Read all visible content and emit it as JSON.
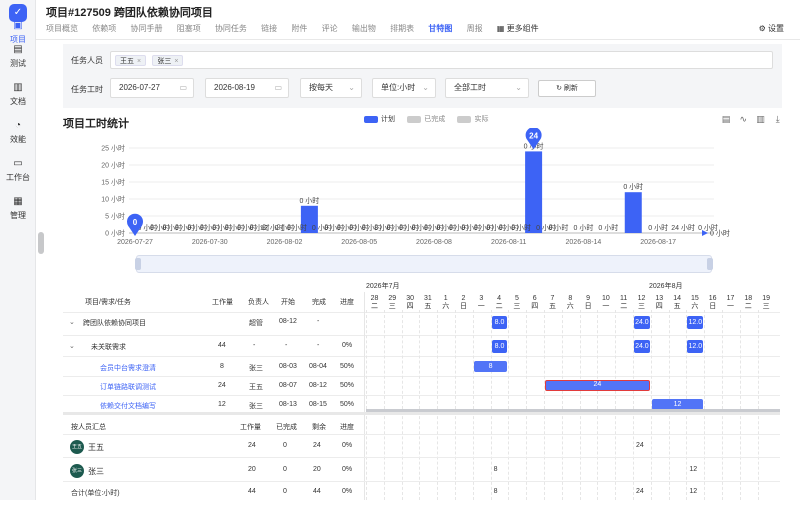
{
  "sidebar": {
    "logo": "✓",
    "items": [
      {
        "label": "项目",
        "icon": "folder-icon",
        "glyph": "▣",
        "active": true
      },
      {
        "label": "测试",
        "icon": "test-icon",
        "glyph": "▤"
      },
      {
        "label": "文档",
        "icon": "document-icon",
        "glyph": "▥"
      },
      {
        "label": "效能",
        "icon": "chart-pie-icon",
        "glyph": "◔"
      },
      {
        "label": "工作台",
        "icon": "desk-icon",
        "glyph": "▭"
      },
      {
        "label": "管理",
        "icon": "manage-icon",
        "glyph": "▦"
      }
    ]
  },
  "header": {
    "title": "项目#127509 跨团队依赖协同项目",
    "tabs": [
      "项目概览",
      "依赖项",
      "协同手册",
      "阻塞项",
      "协同任务",
      "链接",
      "附件",
      "评论",
      "输出物",
      "排期表",
      "甘特图",
      "周报",
      "更多组件"
    ],
    "active_tab": "甘特图",
    "more_icon": "▦",
    "settings_label": "设置",
    "settings_icon": "⚙"
  },
  "filters": {
    "people_label": "任务人员",
    "people": [
      "王五",
      "张三"
    ],
    "chip_remove": "×",
    "time_label": "任务工时",
    "start_date": "2026-07-27",
    "end_date": "2026-08-19",
    "calendar_icon": "▭",
    "caret": "⌄",
    "granularity": "按每天",
    "unit": "单位:小时",
    "scope": "全部工时",
    "refresh_icon": "↻",
    "refresh_label": "刷新"
  },
  "chart_header": {
    "title": "项目工时统计",
    "legend": [
      {
        "name": "计划",
        "color": "#3d63f5"
      },
      {
        "name": "已完成",
        "color": "#cccccc"
      },
      {
        "name": "实际",
        "color": "#cccccc"
      }
    ],
    "tools": [
      "▤",
      "∿",
      "▥",
      "⤓"
    ]
  },
  "chart_data": {
    "type": "bar",
    "series_name": "计划",
    "y_ticks": [
      "0 小时",
      "5 小时",
      "10 小时",
      "15 小时",
      "20 小时",
      "25 小时"
    ],
    "ylim": [
      0,
      25
    ],
    "x_tick_labels": [
      "2026-07-27",
      "2026-07-30",
      "2026-08-02",
      "2026-08-05",
      "2026-08-08",
      "2026-08-11",
      "2026-08-14",
      "2026-08-17"
    ],
    "bar_labels": [
      "0",
      "0 小时",
      "0 小时",
      "0 小时",
      "0 小时",
      "0 小时",
      "0 小时",
      "0 小时",
      "0 小时",
      "0 小时",
      "8 小时",
      "0 小时",
      "0 小时",
      "0 小时",
      "0 小时",
      "0 小时",
      "0 小时",
      "0 小时",
      "0 小时",
      "0 小时",
      "0 小时",
      "0 小时",
      "24 小时",
      "0 小时",
      "0 小时",
      "0 小时",
      "0 小时",
      "0 小时",
      "0 小时",
      "12 小时",
      "0 小时",
      "0 小时",
      "0 小时",
      "0 小时",
      "0 小时",
      "0 小时",
      "0 小时",
      "0 小时",
      "0 小时",
      "0 小时",
      "0 小时"
    ],
    "categories": [
      "2026-07-27",
      "2026-07-28",
      "2026-07-29",
      "2026-07-30",
      "2026-07-31",
      "2026-08-01",
      "2026-08-02",
      "2026-08-03",
      "2026-08-04",
      "2026-08-05",
      "2026-08-06",
      "2026-08-07",
      "2026-08-08",
      "2026-08-09",
      "2026-08-10",
      "2026-08-11",
      "2026-08-12",
      "2026-08-13",
      "2026-08-14",
      "2026-08-15",
      "2026-08-16",
      "2026-08-17",
      "2026-08-18",
      "2026-08-19"
    ],
    "values": [
      0,
      0,
      0,
      0,
      0,
      0,
      0,
      8,
      0,
      0,
      0,
      0,
      0,
      0,
      0,
      0,
      24,
      0,
      0,
      0,
      12,
      0,
      0,
      0
    ],
    "markers": [
      {
        "category": "2026-07-27",
        "label": "0"
      },
      {
        "category": "2026-08-12",
        "label": "24"
      }
    ],
    "end_label": "0 小时",
    "grid": true
  },
  "gantt": {
    "columns": {
      "name": "项目/需求/任务",
      "workload": "工作量",
      "owner": "负责人",
      "start": "开始",
      "end": "完成",
      "progress": "进度"
    },
    "expand_icon": "⌄",
    "rows": [
      {
        "name": "跨团队依赖协同项目",
        "workload": "",
        "owner": "超管",
        "start": "08-12",
        "end": "-",
        "progress": "",
        "level": 0
      },
      {
        "name": "未关联需求",
        "workload": "44",
        "owner": "-",
        "start": "-",
        "end": "-",
        "progress": "0%",
        "level": 1
      },
      {
        "name": "会员中台需求澄清",
        "workload": "8",
        "owner": "张三",
        "start": "08-03",
        "end": "08-04",
        "progress": "50%",
        "level": 2
      },
      {
        "name": "订单链路联调测试",
        "workload": "24",
        "owner": "王五",
        "start": "08-07",
        "end": "08-12",
        "progress": "50%",
        "level": 2
      },
      {
        "name": "依赖交付文档编写",
        "workload": "12",
        "owner": "张三",
        "start": "08-13",
        "end": "08-15",
        "progress": "50%",
        "level": 2
      }
    ],
    "timeline": {
      "month1": "2026年7月",
      "month2": "2026年8月",
      "days": [
        "28",
        "29",
        "30",
        "31",
        "1",
        "2",
        "3",
        "4",
        "5",
        "6",
        "7",
        "8",
        "9",
        "10",
        "11",
        "12",
        "13",
        "14",
        "15",
        "16",
        "17",
        "18",
        "19"
      ],
      "weekdays": [
        "二",
        "三",
        "四",
        "五",
        "六",
        "日",
        "一",
        "二",
        "三",
        "四",
        "五",
        "六",
        "日",
        "一",
        "二",
        "三",
        "四",
        "五",
        "六",
        "日",
        "一",
        "二",
        "三"
      ],
      "project_cells": [
        {
          "day": "4",
          "value": "8.0"
        },
        {
          "day": "12",
          "value": "24.0"
        },
        {
          "day": "15",
          "value": "12.0"
        }
      ],
      "task_bars": [
        {
          "from": "3",
          "to": "4",
          "value": "8"
        },
        {
          "from": "7",
          "to": "12",
          "value": "24",
          "selected": true
        },
        {
          "from": "13",
          "to": "15",
          "value": "12"
        }
      ]
    }
  },
  "summary": {
    "columns": {
      "name": "按人员汇总",
      "workload": "工作量",
      "done": "已完成",
      "remaining": "剩余",
      "progress": "进度"
    },
    "rows": [
      {
        "avatar": "王五",
        "name": "王五",
        "workload": "24",
        "done": "0",
        "remaining": "24",
        "progress": "0%",
        "cells": [
          {
            "day": "12",
            "value": "24"
          }
        ]
      },
      {
        "avatar": "张三",
        "name": "张三",
        "workload": "20",
        "done": "0",
        "remaining": "20",
        "progress": "0%",
        "cells": [
          {
            "day": "4",
            "value": "8"
          },
          {
            "day": "15",
            "value": "12"
          }
        ]
      },
      {
        "avatar": "",
        "name": "合计(单位:小时)",
        "workload": "44",
        "done": "0",
        "remaining": "44",
        "progress": "0%",
        "cells": [
          {
            "day": "4",
            "value": "8"
          },
          {
            "day": "12",
            "value": "24"
          },
          {
            "day": "15",
            "value": "12"
          }
        ]
      }
    ]
  }
}
